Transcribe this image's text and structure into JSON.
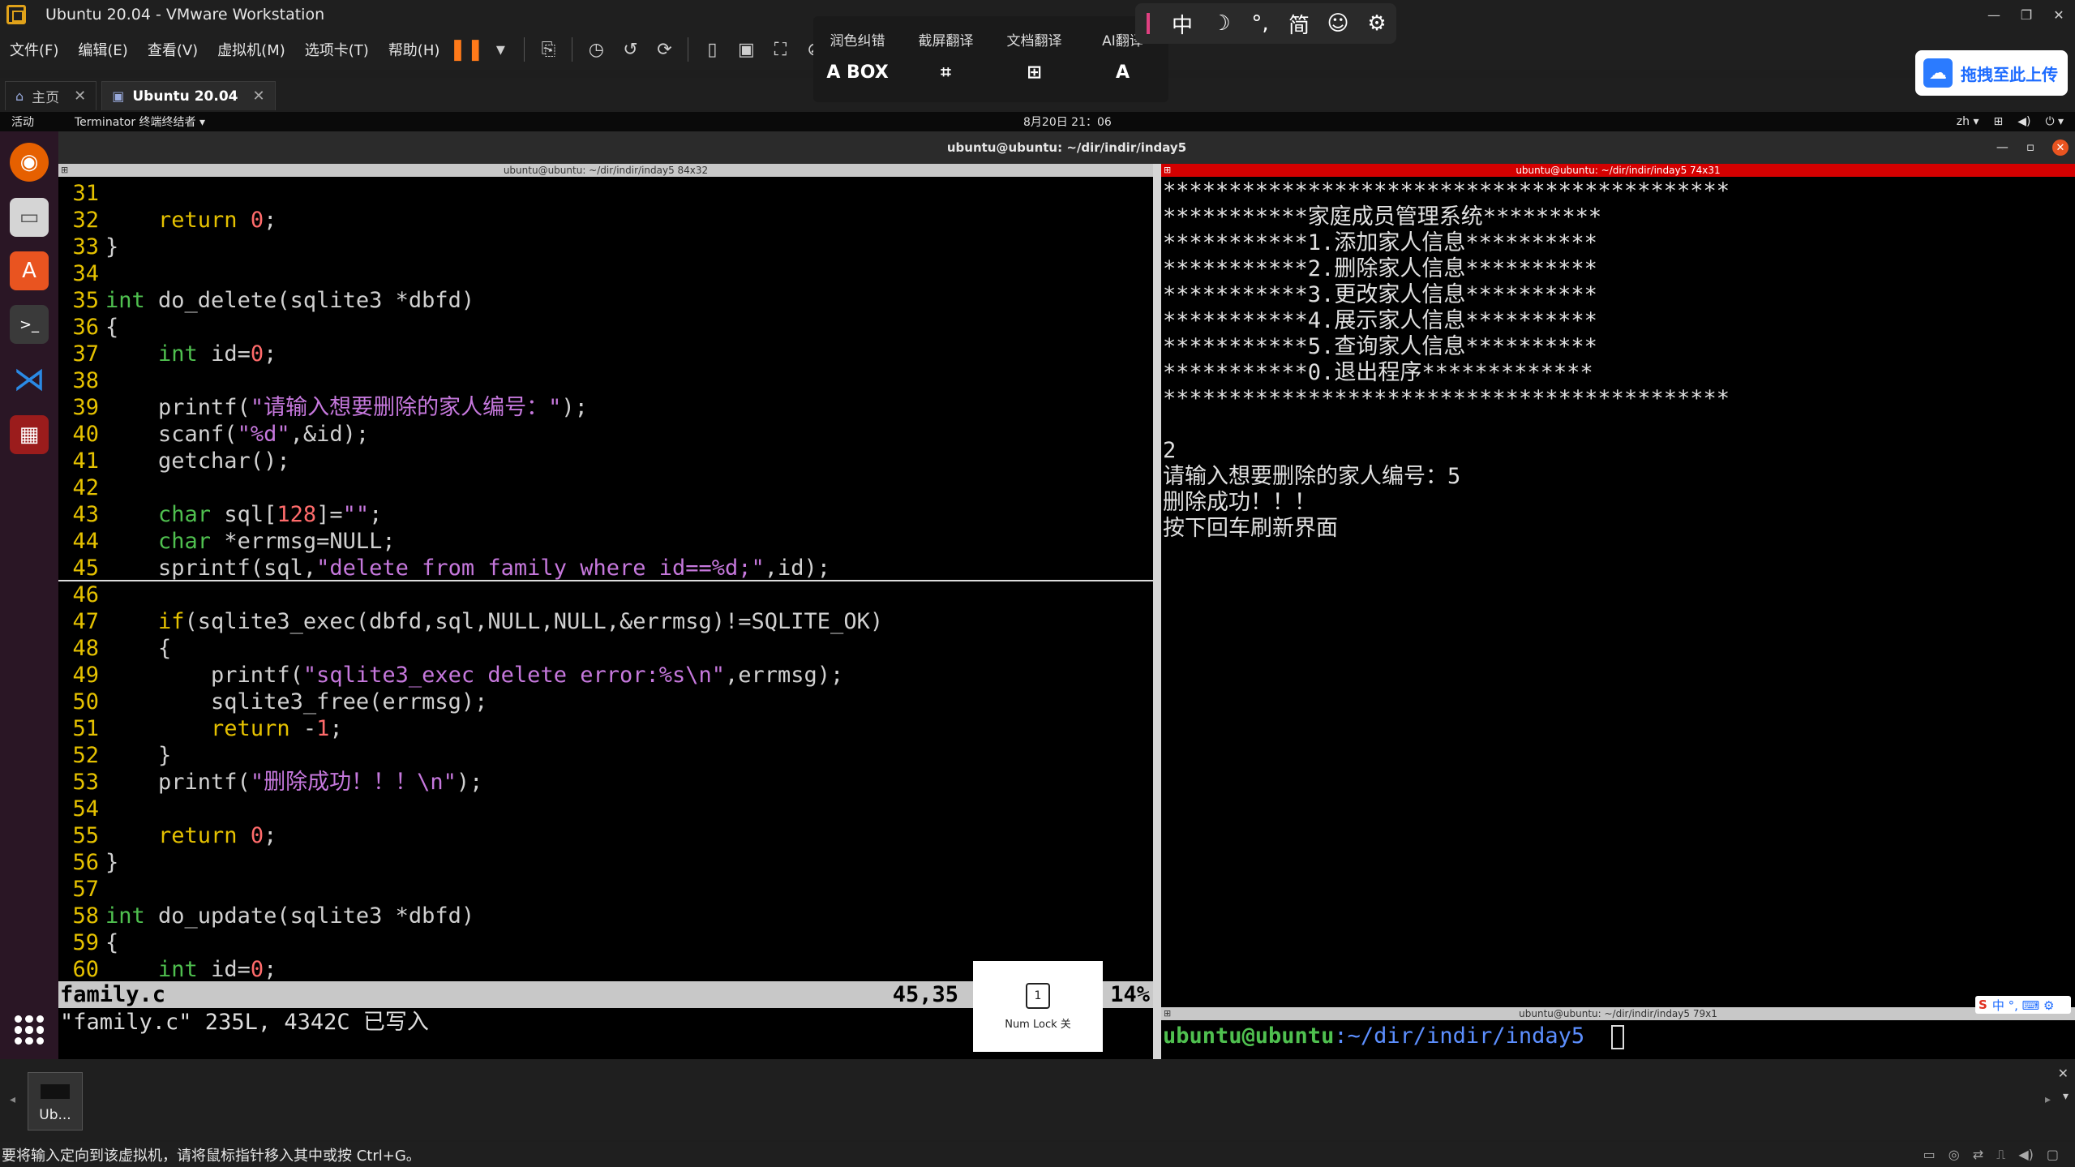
{
  "window": {
    "title": "Ubuntu 20.04 - VMware Workstation"
  },
  "menu": [
    "文件(F)",
    "编辑(E)",
    "查看(V)",
    "虚拟机(M)",
    "选项卡(T)",
    "帮助(H)"
  ],
  "tabs": [
    {
      "label": "主页"
    },
    {
      "label": "Ubuntu 20.04"
    }
  ],
  "translate_bar": [
    {
      "label": "润色纠错",
      "icon": "A BOX"
    },
    {
      "label": "截屏翻译",
      "icon": "⌗"
    },
    {
      "label": "文档翻译",
      "icon": "⊞"
    },
    {
      "label": "AI翻译",
      "icon": "A"
    }
  ],
  "ime": {
    "lang": "中",
    "moon": "☽",
    "punct": "°,",
    "simp": "简",
    "emoji": "☺",
    "gear": "⚙"
  },
  "upload": {
    "label": "拖拽至此上传"
  },
  "ubuntu_panel": {
    "activities": "活动",
    "app": "Terminator 终端终结者 ▾",
    "clock": "8月20日 21：06",
    "lang": "zh ▾"
  },
  "terminator": {
    "title": "ubuntu@ubuntu: ~/dir/indir/inday5"
  },
  "left_pane": {
    "title": "ubuntu@ubuntu: ~/dir/indir/inday5 84x32",
    "lines": [
      {
        "n": "31",
        "t": ""
      },
      {
        "n": "32",
        "t": "    return 0;"
      },
      {
        "n": "33",
        "t": "}"
      },
      {
        "n": "34",
        "t": ""
      },
      {
        "n": "35",
        "t": "int do_delete(sqlite3 *dbfd)"
      },
      {
        "n": "36",
        "t": "{"
      },
      {
        "n": "37",
        "t": "    int id=0;"
      },
      {
        "n": "38",
        "t": ""
      },
      {
        "n": "39",
        "t": "    printf(\"请输入想要删除的家人编号：\");"
      },
      {
        "n": "40",
        "t": "    scanf(\"%d\",&id);"
      },
      {
        "n": "41",
        "t": "    getchar();"
      },
      {
        "n": "42",
        "t": ""
      },
      {
        "n": "43",
        "t": "    char sql[128]=\"\";"
      },
      {
        "n": "44",
        "t": "    char *errmsg=NULL;"
      },
      {
        "n": "45",
        "t": "    sprintf(sql,\"delete from family where id==%d;\",id);"
      },
      {
        "n": "46",
        "t": ""
      },
      {
        "n": "47",
        "t": "    if(sqlite3_exec(dbfd,sql,NULL,NULL,&errmsg)!=SQLITE_OK)"
      },
      {
        "n": "48",
        "t": "    {"
      },
      {
        "n": "49",
        "t": "        printf(\"sqlite3_exec delete error:%s\\n\",errmsg);"
      },
      {
        "n": "50",
        "t": "        sqlite3_free(errmsg);"
      },
      {
        "n": "51",
        "t": "        return -1;"
      },
      {
        "n": "52",
        "t": "    }"
      },
      {
        "n": "53",
        "t": "    printf(\"删除成功！！！\\n\");"
      },
      {
        "n": "54",
        "t": ""
      },
      {
        "n": "55",
        "t": "    return 0;"
      },
      {
        "n": "56",
        "t": "}"
      },
      {
        "n": "57",
        "t": ""
      },
      {
        "n": "58",
        "t": "int do_update(sqlite3 *dbfd)"
      },
      {
        "n": "59",
        "t": "{"
      },
      {
        "n": "60",
        "t": "    int id=0;"
      }
    ],
    "status_file": "family.c",
    "status_pos": "45,35",
    "status_pct": "14%",
    "cmdline": "\"family.c\" 235L, 4342C 已写入"
  },
  "right_pane": {
    "title": "ubuntu@ubuntu: ~/dir/indir/inday5 74x31",
    "lines": [
      "*******************************************",
      "***********家庭成员管理系统*********",
      "***********1.添加家人信息**********",
      "***********2.删除家人信息**********",
      "***********3.更改家人信息**********",
      "***********4.展示家人信息**********",
      "***********5.查询家人信息**********",
      "***********0.退出程序*************",
      "*******************************************",
      "",
      "2",
      "请输入想要删除的家人编号：5",
      "删除成功！！！",
      "按下回车刷新界面"
    ]
  },
  "bottom_pane": {
    "title": "ubuntu@ubuntu: ~/dir/indir/inday5 79x1",
    "prompt_user": "ubuntu@ubuntu",
    "prompt_path": ":~/dir/indir/inday5",
    "prompt_sym": "$ "
  },
  "numlock": {
    "label": "Num Lock 关",
    "icon": "1"
  },
  "sogou": {
    "brand": "S",
    "items": "中 °, ⌨ ⚙"
  },
  "thumbnail": {
    "label": "Ub..."
  },
  "statusbar": {
    "text": "要将输入定向到该虚拟机，请将鼠标指针移入其中或按 Ctrl+G。"
  }
}
